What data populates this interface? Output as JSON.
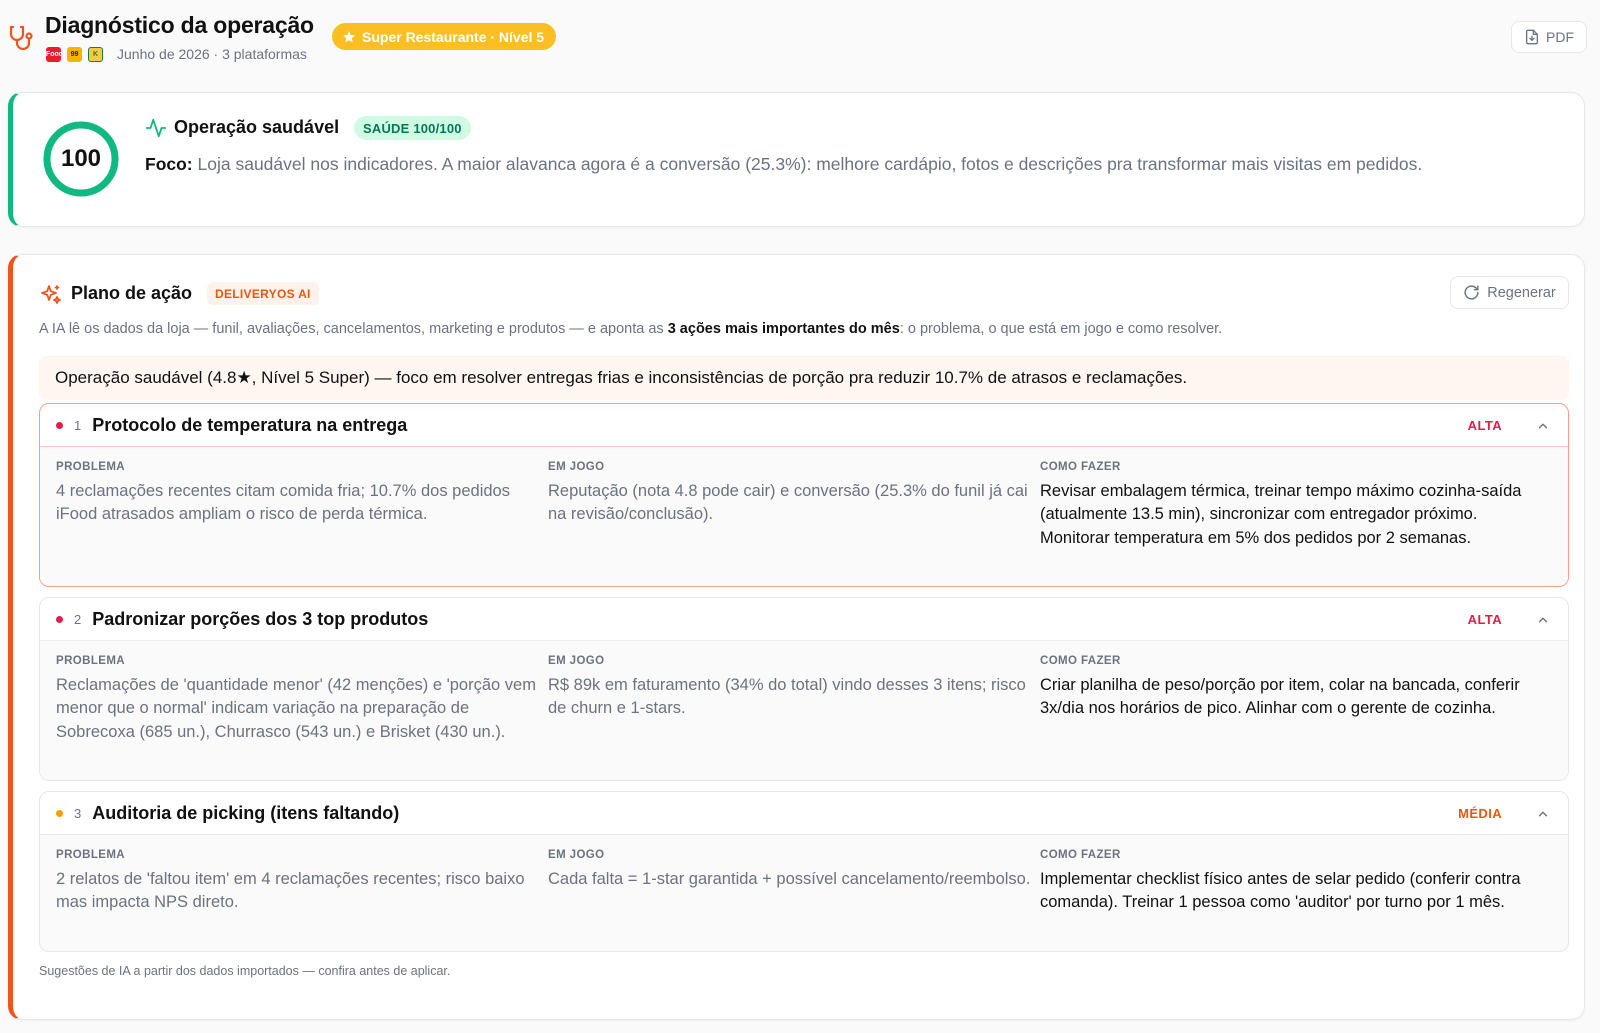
{
  "header": {
    "title": "Diagnóstico da operação",
    "badge": "Super Restaurante · Nível 5",
    "platforms": [
      "iFood",
      "99",
      "Keeta"
    ],
    "platform_glyphs": [
      "iFood",
      "99",
      "K"
    ],
    "subtitle": "Junho de 2026 · 3 plataformas",
    "pdf_label": "PDF"
  },
  "health": {
    "score": 100,
    "score_label": "100",
    "title": "Operação saudável",
    "badge": "SAÚDE 100/100",
    "focus_label": "Foco:",
    "focus_text": "Loja saudável nos indicadores. A maior alavanca agora é a conversão (25.3%): melhore cardápio, fotos e descrições pra transformar mais visitas em pedidos.",
    "color": "#10b981"
  },
  "plan": {
    "title": "Plano de ação",
    "badge": "DELIVERYOS AI",
    "regen_label": "Regenerar",
    "desc_pre": "A IA lê os dados da loja — funil, avaliações, cancelamentos, marketing e produtos — e aponta as ",
    "desc_bold": "3 ações mais importantes do mês",
    "desc_post": ": o problema, o que está em jogo e como resolver.",
    "summary": "Operação saudável (4.8★, Nível 5 Super) — foco em resolver entregas frias e inconsistências de porção pra reduzir 10.7% de atrasos e reclamações.",
    "col_labels": {
      "problem": "PROBLEMA",
      "stake": "EM JOGO",
      "how": "COMO FAZER"
    },
    "items": [
      {
        "num": "1",
        "title": "Protocolo de temperatura na entrega",
        "priority": "ALTA",
        "problem": "4 reclamações recentes citam comida fria; 10.7% dos pedidos iFood atrasados ampliam o risco de perda térmica.",
        "stake": "Reputação (nota 4.8 pode cair) e conversão (25.3% do funil já cai na revisão/conclusão).",
        "how": "Revisar embalagem térmica, treinar tempo máximo cozinha-saída (atualmente 13.5 min), sincronizar com entregador próximo. Monitorar temperatura em 5% dos pedidos por 2 semanas."
      },
      {
        "num": "2",
        "title": "Padronizar porções dos 3 top produtos",
        "priority": "ALTA",
        "problem": "Reclamações de 'quantidade menor' (42 menções) e 'porção vem menor que o normal' indicam variação na preparação de Sobrecoxa (685 un.), Churrasco (543 un.) e Brisket (430 un.).",
        "stake": "R$ 89k em faturamento (34% do total) vindo desses 3 itens; risco de churn e 1-stars.",
        "how": "Criar planilha de peso/porção por item, colar na bancada, conferir 3x/dia nos horários de pico. Alinhar com o gerente de cozinha."
      },
      {
        "num": "3",
        "title": "Auditoria de picking (itens faltando)",
        "priority": "MÉDIA",
        "problem": "2 relatos de 'faltou item' em 4 reclamações recentes; risco baixo mas impacta NPS direto.",
        "stake": "Cada falta = 1-star garantida + possível cancelamento/reembolso.",
        "how": "Implementar checklist físico antes de selar pedido (conferir contra comanda). Treinar 1 pessoa como 'auditor' por turno por 1 mês."
      }
    ],
    "disclaimer": "Sugestões de IA a partir dos dados importados — confira antes de aplicar.",
    "accent": "#f0541e",
    "priority_colors": {
      "ALTA": "#e11d48",
      "MÉDIA": "#ea580c"
    }
  },
  "icons": {
    "header": "stethoscope-icon",
    "badge": "star-icon",
    "pdf": "file-download-icon",
    "health": "pulse-icon",
    "plan": "sparkles-icon",
    "regen": "refresh-icon",
    "toggle": "chevron-up-icon"
  }
}
